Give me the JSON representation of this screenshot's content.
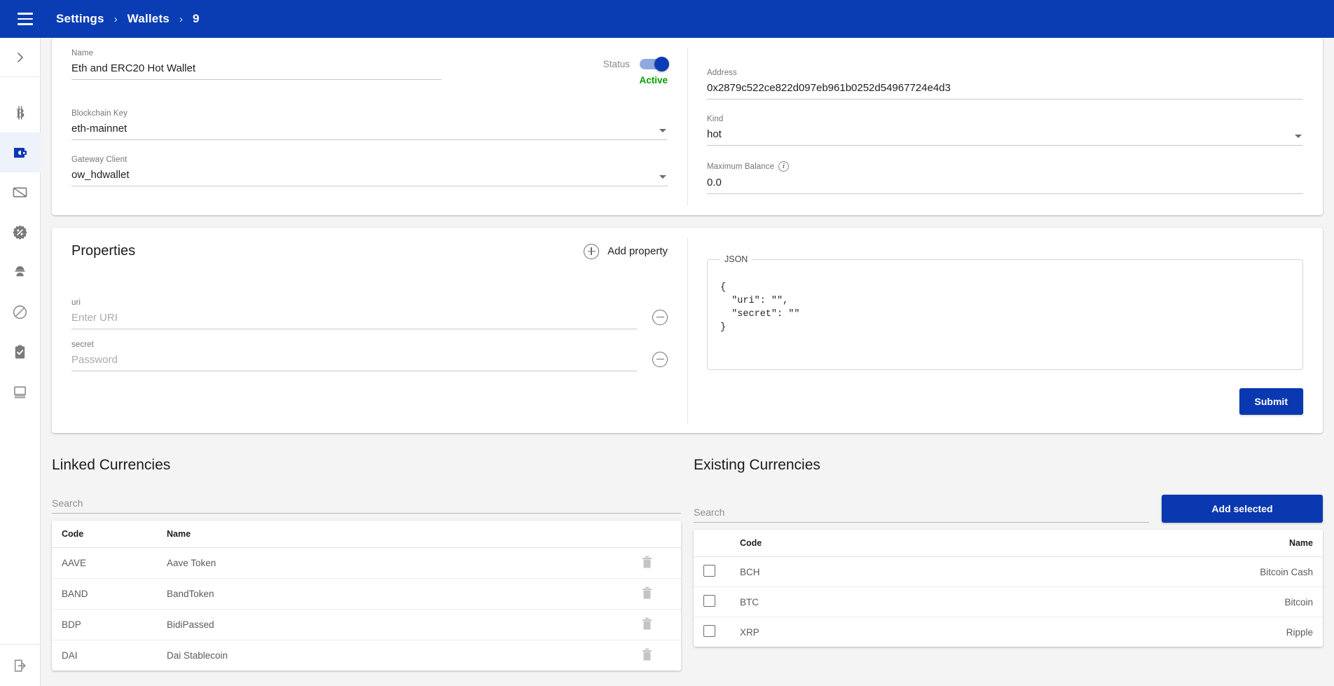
{
  "appbar": {
    "menu_icon": "hamburger-icon",
    "breadcrumbs": [
      "Settings",
      "Wallets",
      "9"
    ],
    "separator": "›"
  },
  "sidebar": {
    "expand_icon": "chevron-right-icon",
    "items": [
      {
        "icon": "bitcoin-icon",
        "active": false
      },
      {
        "icon": "wallet-icon",
        "active": true
      },
      {
        "icon": "card-off-icon",
        "active": false
      },
      {
        "icon": "percent-badge-icon",
        "active": false
      },
      {
        "icon": "user-worker-icon",
        "active": false
      },
      {
        "icon": "block-icon",
        "active": false
      },
      {
        "icon": "clipboard-check-icon",
        "active": false
      },
      {
        "icon": "monitor-icon",
        "active": false
      }
    ],
    "logout_icon": "logout-icon"
  },
  "wallet_form": {
    "name": {
      "label": "Name",
      "value": "Eth and ERC20 Hot Wallet"
    },
    "blockchain_key": {
      "label": "Blockchain Key",
      "value": "eth-mainnet"
    },
    "gateway_client": {
      "label": "Gateway Client",
      "value": "ow_hdwallet"
    },
    "status": {
      "label": "Status",
      "value": "Active",
      "enabled": true,
      "color": "#00a000"
    },
    "address": {
      "label": "Address",
      "value": "0x2879c522ce822d097eb961b0252d54967724e4d3"
    },
    "kind": {
      "label": "Kind",
      "value": "hot"
    },
    "maximum_balance": {
      "label": "Maximum Balance",
      "value": "0.0",
      "info_icon": "info-icon"
    }
  },
  "properties": {
    "title": "Properties",
    "add_label": "Add property",
    "add_icon": "plus-circle-icon",
    "remove_icon": "minus-circle-icon",
    "rows": [
      {
        "label": "uri",
        "value": "",
        "placeholder": "Enter URI"
      },
      {
        "label": "secret",
        "value": "",
        "placeholder": "Password"
      }
    ],
    "json": {
      "legend": "JSON",
      "content": "{\n  \"uri\": \"\",\n  \"secret\": \"\"\n}"
    },
    "submit_label": "Submit"
  },
  "linked_currencies": {
    "title": "Linked Currencies",
    "search_placeholder": "Search",
    "search_value": "",
    "columns": [
      "Code",
      "Name",
      ""
    ],
    "delete_icon": "trash-icon",
    "rows": [
      {
        "code": "AAVE",
        "name": "Aave Token"
      },
      {
        "code": "BAND",
        "name": "BandToken"
      },
      {
        "code": "BDP",
        "name": "BidiPassed"
      },
      {
        "code": "DAI",
        "name": "Dai Stablecoin"
      }
    ]
  },
  "existing_currencies": {
    "title": "Existing Currencies",
    "search_placeholder": "Search",
    "search_value": "",
    "add_button_label": "Add selected",
    "columns": [
      "",
      "Code",
      "Name"
    ],
    "checkbox_icon": "checkbox-icon",
    "rows": [
      {
        "code": "BCH",
        "name": "Bitcoin Cash",
        "checked": false
      },
      {
        "code": "BTC",
        "name": "Bitcoin",
        "checked": false
      },
      {
        "code": "XRP",
        "name": "Ripple",
        "checked": false
      }
    ]
  },
  "theme": {
    "primary": "#0a3db3",
    "active_nav_bg": "#eef2fa",
    "page_bg": "#f4f4f4",
    "success": "#00a000"
  }
}
